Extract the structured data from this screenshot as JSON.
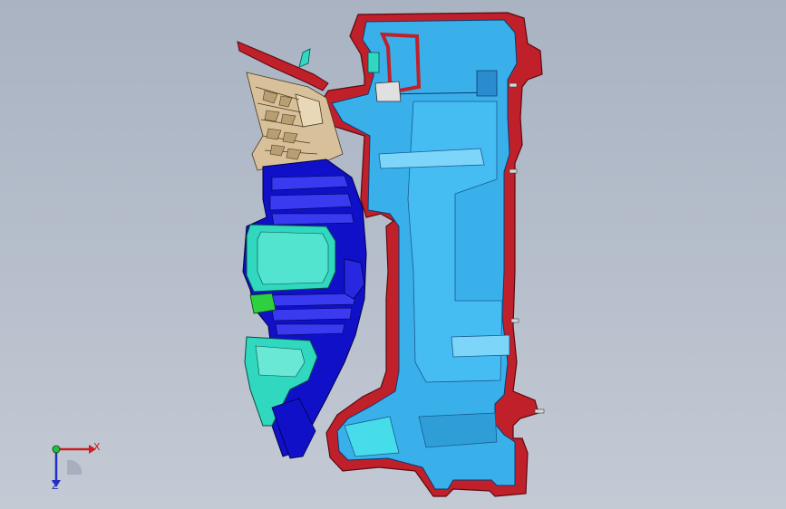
{
  "viewport": {
    "colors": {
      "housing": "#3ab0ea",
      "rim": "#c0202a",
      "bracket": "#1010c8",
      "screen": "#30d8c0",
      "tan": "#d8c09a"
    }
  },
  "triad": {
    "x_label": "X",
    "z_label": "Z",
    "icon": "coordinate-triad-icon"
  }
}
